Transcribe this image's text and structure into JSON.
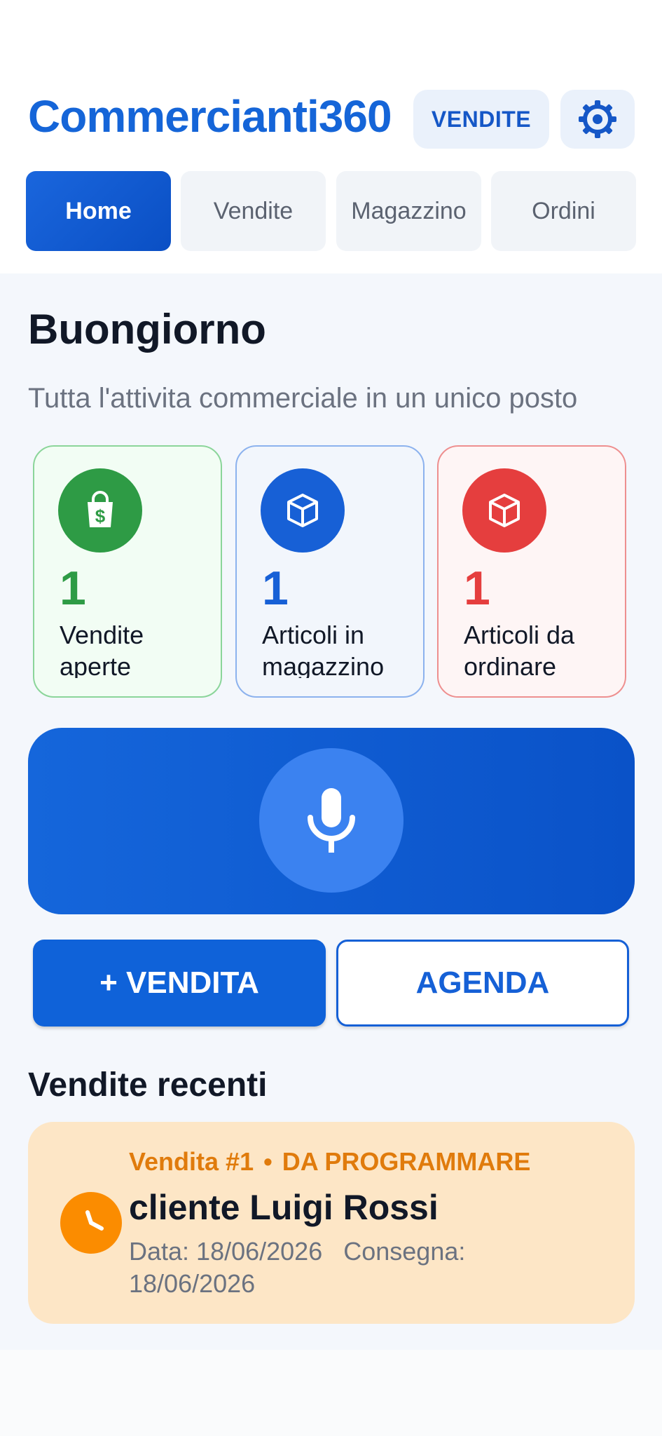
{
  "app": {
    "title": "Commercianti360",
    "mode_button": "VENDITE",
    "settings_icon": "gear-icon"
  },
  "tabs": [
    {
      "label": "Home",
      "active": true
    },
    {
      "label": "Vendite",
      "active": false
    },
    {
      "label": "Magazzino",
      "active": false
    },
    {
      "label": "Ordini",
      "active": false
    }
  ],
  "greeting": {
    "title": "Buongiorno",
    "subtitle": "Tutta l'attivita commerciale in un unico posto"
  },
  "stats": [
    {
      "value": "1",
      "label": "Vendite aperte",
      "icon": "shopping-bag-dollar-icon",
      "accent": "#2e9b45",
      "bg": "#f2fdf4",
      "border": "#8bd59a"
    },
    {
      "value": "1",
      "label": "Articoli in magazzino",
      "icon": "box-icon",
      "accent": "#1760d6",
      "bg": "#f2f6fc",
      "border": "#8cb2ee"
    },
    {
      "value": "1",
      "label": "Articoli da ordinare",
      "icon": "box-icon",
      "accent": "#e53e3e",
      "bg": "#fef5f5",
      "border": "#ee8f8f"
    }
  ],
  "voice": {
    "icon": "microphone-icon"
  },
  "actions": {
    "new_sale": "+ VENDITA",
    "agenda": "AGENDA"
  },
  "recent": {
    "title": "Vendite recenti",
    "items": [
      {
        "number": "Vendita #1",
        "status": "DA PROGRAMMARE",
        "client": "cliente Luigi Rossi",
        "date_label": "Data: 18/06/2026",
        "delivery_label": "Consegna: 18/06/2026",
        "icon": "clock-icon"
      }
    ]
  },
  "colors": {
    "primary": "#1565d8",
    "warning_bg": "#fde6c6",
    "warning_text": "#e07b0c"
  }
}
